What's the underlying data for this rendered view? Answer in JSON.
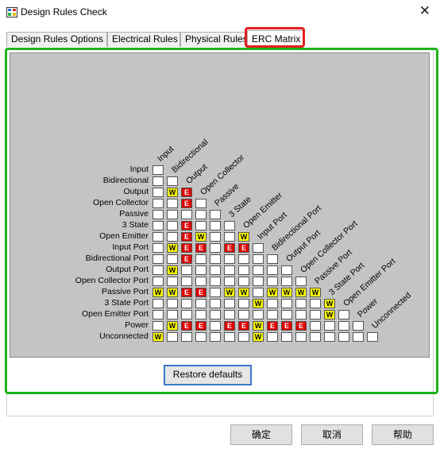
{
  "window": {
    "title": "Design Rules Check",
    "close_glyph": "✕"
  },
  "tabs": [
    {
      "label": "Design Rules Options",
      "active": false
    },
    {
      "label": "Electrical Rules",
      "active": false
    },
    {
      "label": "Physical Rules",
      "active": false
    },
    {
      "label": "ERC Matrix",
      "active": true
    }
  ],
  "matrix": {
    "pins": [
      "Input",
      "Bidirectional",
      "Output",
      "Open Collector",
      "Passive",
      "3 State",
      "Open Emitter",
      "Input Port",
      "Bidirectional Port",
      "Output Port",
      "Open Collector Port",
      "Passive Port",
      "3 State Port",
      "Open Emitter Port",
      "Power",
      "Unconnected"
    ],
    "rows": [
      [
        "-"
      ],
      [
        "-",
        "-"
      ],
      [
        "-",
        "W",
        "E"
      ],
      [
        "-",
        "-",
        "E",
        "-"
      ],
      [
        "-",
        "-",
        "-",
        "-",
        "-"
      ],
      [
        "-",
        "-",
        "E",
        "-",
        "-",
        "-"
      ],
      [
        "-",
        "-",
        "E",
        "W",
        "-",
        "-",
        "W"
      ],
      [
        "-",
        "W",
        "E",
        "E",
        "-",
        "E",
        "E",
        "-"
      ],
      [
        "-",
        "-",
        "E",
        "-",
        "-",
        "-",
        "-",
        "-",
        "-"
      ],
      [
        "-",
        "W",
        "-",
        "-",
        "-",
        "-",
        "-",
        "-",
        "-",
        "-"
      ],
      [
        "-",
        "-",
        "-",
        "-",
        "-",
        "-",
        "-",
        "-",
        "-",
        "-",
        "-"
      ],
      [
        "W",
        "W",
        "E",
        "E",
        "-",
        "W",
        "W",
        "-",
        "W",
        "W",
        "W",
        "W"
      ],
      [
        "-",
        "-",
        "-",
        "-",
        "-",
        "-",
        "-",
        "W",
        "-",
        "-",
        "-",
        "-",
        "W"
      ],
      [
        "-",
        "-",
        "-",
        "-",
        "-",
        "-",
        "-",
        "-",
        "-",
        "-",
        "-",
        "-",
        "W",
        "-"
      ],
      [
        "-",
        "W",
        "E",
        "E",
        "-",
        "E",
        "E",
        "W",
        "E",
        "E",
        "E",
        "-",
        "-",
        "-",
        "-"
      ],
      [
        "W",
        "-",
        "-",
        "-",
        "-",
        "-",
        "-",
        "W",
        "-",
        "-",
        "-",
        "-",
        "-",
        "-",
        "-",
        "-"
      ]
    ]
  },
  "restore_button": {
    "label": "Restore defaults"
  },
  "footer_buttons": {
    "ok": "确定",
    "cancel": "取消",
    "help": "帮助"
  },
  "colors": {
    "warning": "#ffff00",
    "error": "#e00000",
    "no_report": "#ffffff",
    "matrix_bg": "#c4c4c4",
    "highlight_tab": "#e61e1e",
    "highlight_panel": "#1db31d"
  }
}
